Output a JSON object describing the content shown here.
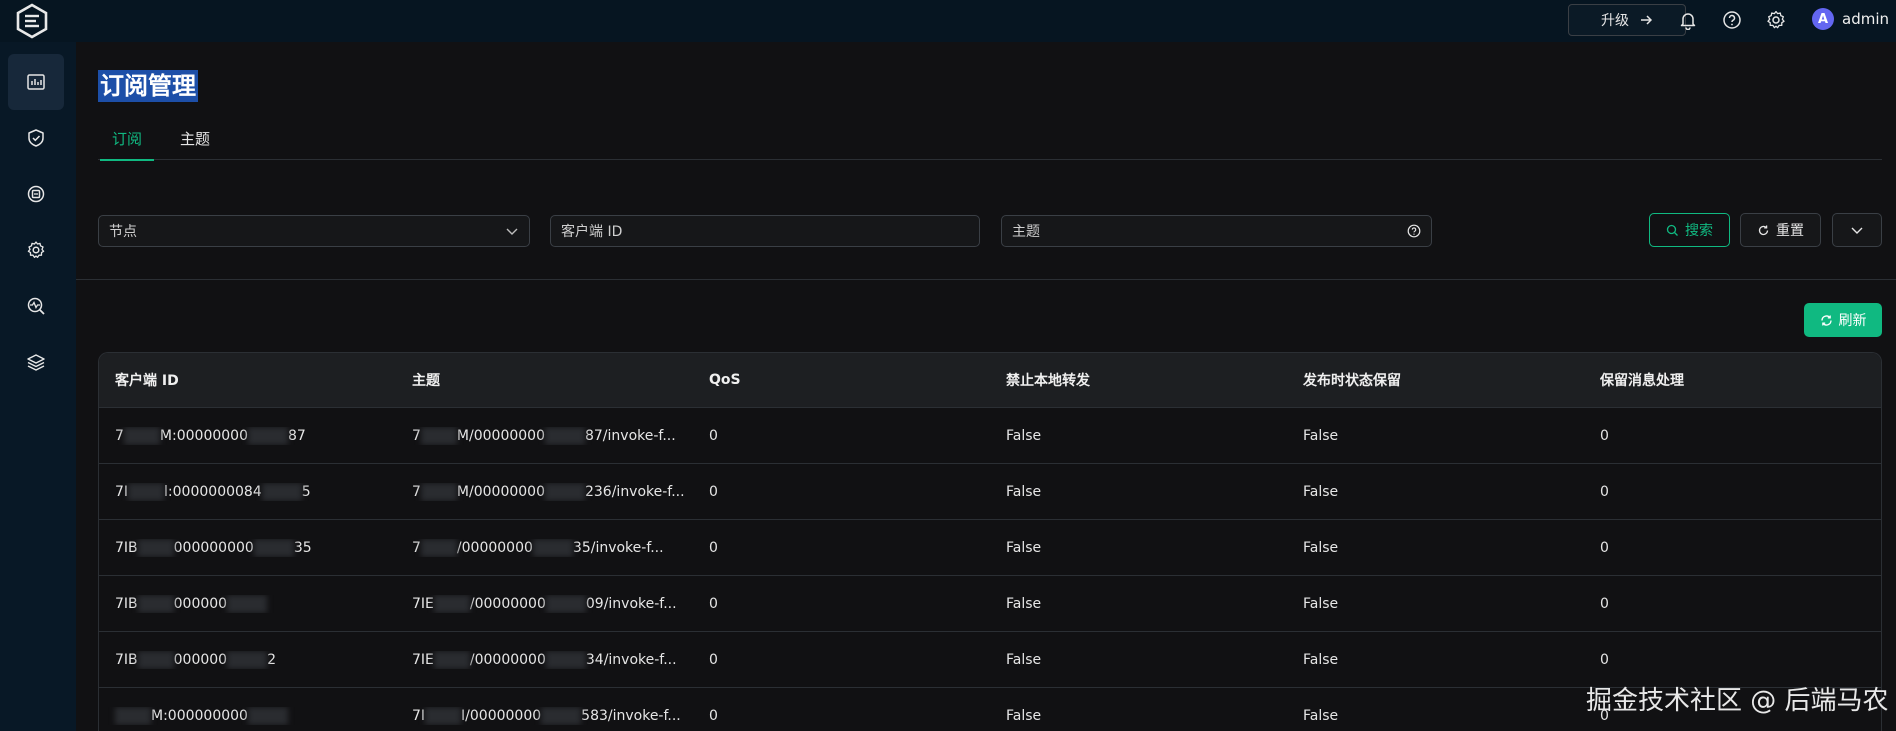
{
  "topbar": {
    "upgrade_label": "升级",
    "username": "admin",
    "avatar_letter": "A"
  },
  "page": {
    "title": "订阅管理"
  },
  "tabs": [
    {
      "label": "订阅",
      "active": true
    },
    {
      "label": "主题",
      "active": false
    }
  ],
  "filters": {
    "node_placeholder": "节点",
    "client_id_placeholder": "客户端 ID",
    "topic_placeholder": "主题",
    "search_label": "搜索",
    "reset_label": "重置"
  },
  "refresh_label": "刷新",
  "table": {
    "headers": [
      "客户端 ID",
      "主题",
      "QoS",
      "禁止本地转发",
      "发布时状态保留",
      "保留消息处理"
    ],
    "rows": [
      {
        "client_prefix": "7",
        "client_mid": "M:00000000",
        "client_suffix": "87",
        "topic_prefix": "7",
        "topic_mid": "M/00000000",
        "topic_suffix": "87/invoke-f...",
        "qos": "0",
        "nl": "False",
        "rap": "False",
        "rh": "0"
      },
      {
        "client_prefix": "7I",
        "client_mid": "l:0000000084",
        "client_suffix": "5",
        "topic_prefix": "7",
        "topic_mid": "M/00000000",
        "topic_suffix": "236/invoke-f...",
        "qos": "0",
        "nl": "False",
        "rap": "False",
        "rh": "0"
      },
      {
        "client_prefix": "7IB",
        "client_mid": "000000000",
        "client_suffix": "35",
        "topic_prefix": "7",
        "topic_mid": "/00000000",
        "topic_suffix": "35/invoke-f...",
        "qos": "0",
        "nl": "False",
        "rap": "False",
        "rh": "0"
      },
      {
        "client_prefix": "7IB",
        "client_mid": "000000",
        "client_suffix": "",
        "topic_prefix": "7IE",
        "topic_mid": "/00000000",
        "topic_suffix": "09/invoke-f...",
        "qos": "0",
        "nl": "False",
        "rap": "False",
        "rh": "0"
      },
      {
        "client_prefix": "7IB",
        "client_mid": "000000",
        "client_suffix": "2",
        "topic_prefix": "7IE",
        "topic_mid": "/00000000",
        "topic_suffix": "34/invoke-f...",
        "qos": "0",
        "nl": "False",
        "rap": "False",
        "rh": "0"
      },
      {
        "client_prefix": "",
        "client_mid": "M:000000000",
        "client_suffix": "",
        "topic_prefix": "7I",
        "topic_mid": "I/00000000",
        "topic_suffix": "583/invoke-f...",
        "qos": "0",
        "nl": "False",
        "rap": "False",
        "rh": "0"
      }
    ]
  },
  "watermark": "掘金技术社区 @ 后端马农",
  "colors": {
    "accent": "#10b981",
    "topbar": "#061521",
    "sidebar": "#081826",
    "background": "#111113"
  },
  "icons": {
    "sidebar": [
      "dashboard-icon",
      "shield-icon",
      "integration-icon",
      "settings-gear-icon",
      "diagnose-icon",
      "layers-icon"
    ],
    "topbar": [
      "bell-icon",
      "help-icon",
      "gear-icon"
    ]
  }
}
